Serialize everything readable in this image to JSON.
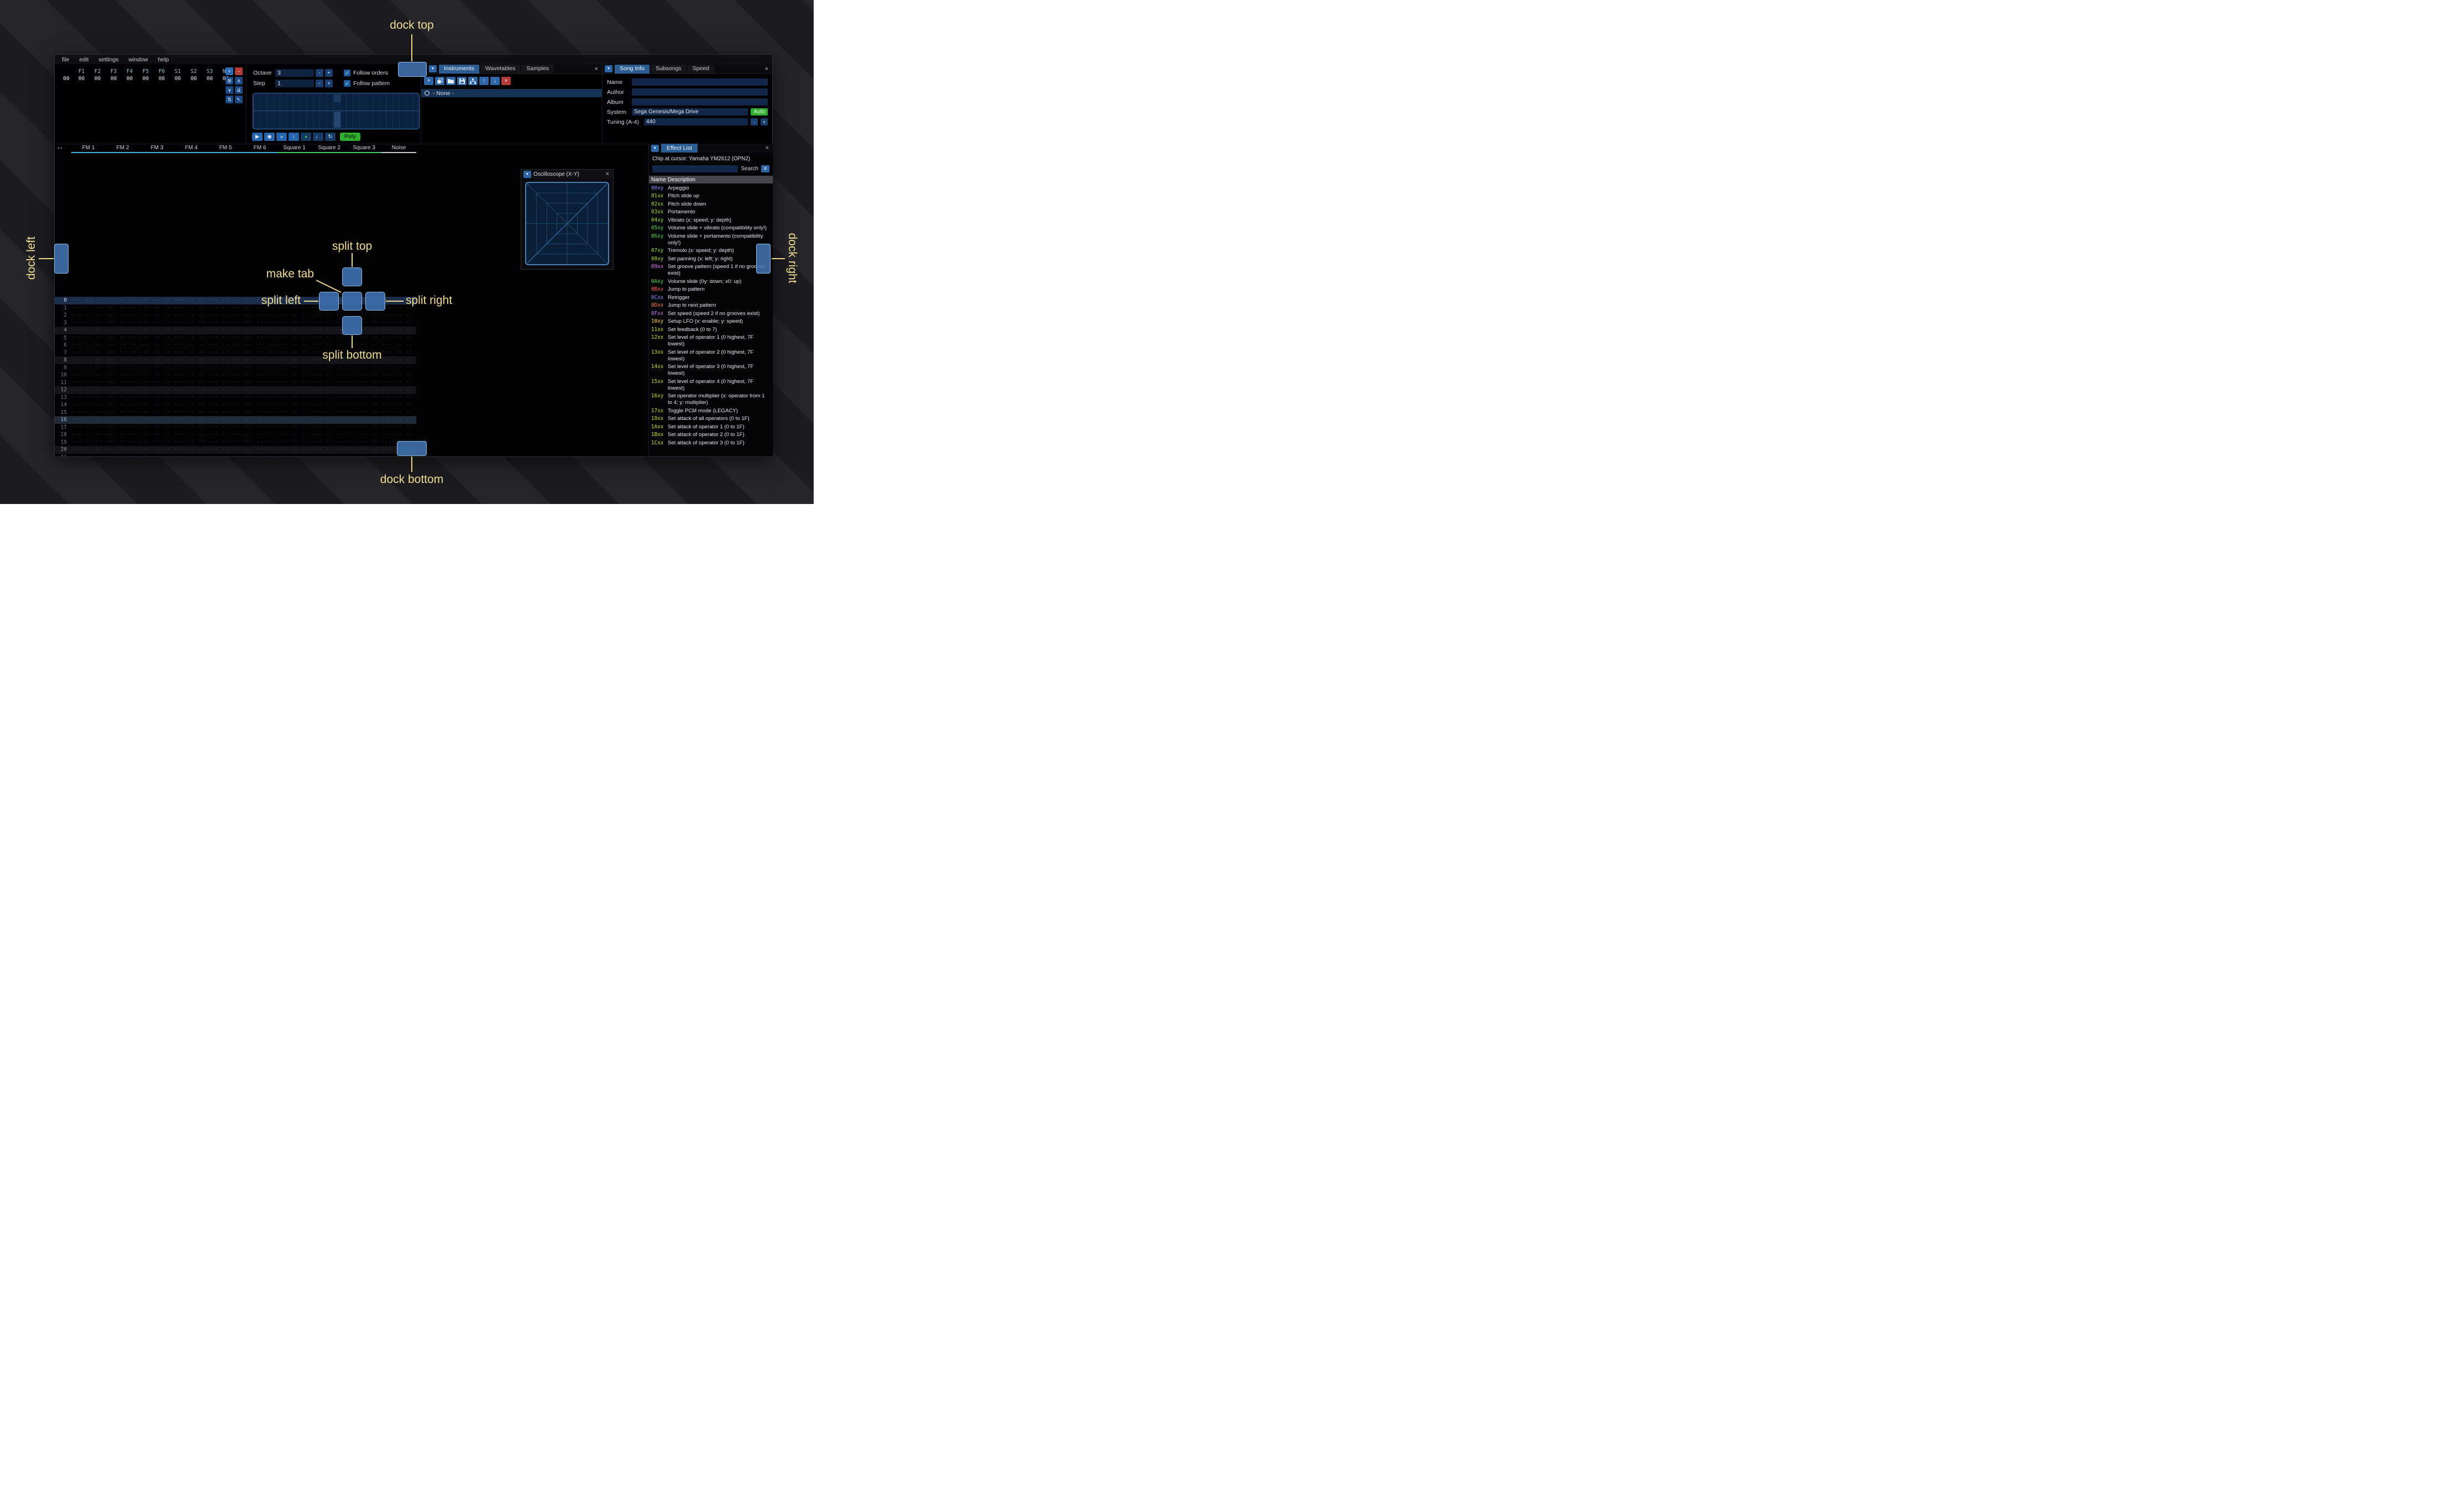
{
  "menu": {
    "items": [
      "file",
      "edit",
      "settings",
      "window",
      "help"
    ]
  },
  "orders": {
    "channels": [
      "F1",
      "F2",
      "F3",
      "F4",
      "F5",
      "F6",
      "S1",
      "S2",
      "S3",
      "N0"
    ],
    "order_index": "00",
    "order_values": [
      "00",
      "00",
      "00",
      "00",
      "00",
      "00",
      "00",
      "00",
      "00",
      "00"
    ],
    "buttons": [
      {
        "name": "add-order-button",
        "glyph": "+",
        "style": "blue"
      },
      {
        "name": "remove-order-button",
        "glyph": "−",
        "style": "red"
      },
      {
        "name": "duplicate-order-button",
        "glyph": "⊞",
        "style": "mid"
      },
      {
        "name": "move-order-up-button",
        "glyph": "∧",
        "style": "mid"
      },
      {
        "name": "move-order-down-button",
        "glyph": "∨",
        "style": "mid"
      },
      {
        "name": "duplicate-order-to-end-button",
        "glyph": "⇊",
        "style": "mid"
      },
      {
        "name": "order-change-mode-button",
        "glyph": "⇅",
        "style": "mid"
      },
      {
        "name": "order-edit-mode-button",
        "glyph": "↖",
        "style": "mid"
      }
    ]
  },
  "controls": {
    "octave_label": "Octave",
    "octave_value": "3",
    "step_label": "Step",
    "step_value": "1",
    "minus_label": "-",
    "plus_label": "+",
    "check_glyph": "✓",
    "follow_orders_label": "Follow orders",
    "follow_pattern_label": "Follow pattern",
    "transport": [
      {
        "name": "play-button",
        "glyph": "▶",
        "style": "blue"
      },
      {
        "name": "play-pattern-button",
        "glyph": "◉",
        "style": "blue"
      },
      {
        "name": "play-once-button",
        "glyph": "»",
        "style": "blue"
      },
      {
        "name": "step-row-button",
        "glyph": "↓",
        "style": "blue"
      },
      {
        "name": "edit-toggle-button",
        "glyph": "●",
        "style": "toggle"
      },
      {
        "name": "metronome-button",
        "glyph": "♩",
        "style": "dark"
      },
      {
        "name": "repeat-pattern-button",
        "glyph": "↻",
        "style": "dark"
      }
    ],
    "poly_label": "Poly"
  },
  "instruments": {
    "collapse_icon": "▼",
    "tabs": [
      "Instruments",
      "Wavetables",
      "Samples"
    ],
    "active_tab": "Instruments",
    "close_icon": "×",
    "toolbar": [
      {
        "name": "add-instrument-button",
        "icon": "plus",
        "style": "blue"
      },
      {
        "name": "duplicate-instrument-button",
        "icon": "copy",
        "style": "blue"
      },
      {
        "name": "open-instrument-button",
        "icon": "folder",
        "style": "blue"
      },
      {
        "name": "save-instrument-button",
        "icon": "floppy",
        "style": "blue"
      },
      {
        "name": "instrument-folder-button",
        "icon": "sitemap",
        "style": "blue"
      },
      {
        "name": "move-instrument-up-button",
        "icon": "arrow-up",
        "style": "blue"
      },
      {
        "name": "move-instrument-down-button",
        "icon": "arrow-down",
        "style": "blue"
      },
      {
        "name": "delete-instrument-button",
        "icon": "delete",
        "style": "red"
      }
    ],
    "none_item": "- None -"
  },
  "song_info": {
    "collapse_icon": "▼",
    "tabs": [
      "Song Info",
      "Subsongs",
      "Speed"
    ],
    "active_tab": "Song Info",
    "close_icon": "×",
    "fields": [
      {
        "label": "Name",
        "value": ""
      },
      {
        "label": "Author",
        "value": ""
      },
      {
        "label": "Album",
        "value": ""
      }
    ],
    "system_label": "System",
    "system_value": "Sega Genesis/Mega Drive",
    "auto_label": "Auto",
    "tuning_label": "Tuning (A-4)",
    "tuning_value": "440",
    "minus_label": "-",
    "plus_label": "+"
  },
  "pattern": {
    "corner_label": "++",
    "channels": [
      {
        "name": "FM 1",
        "underline": "#3fb6e0",
        "width": 62
      },
      {
        "name": "FM 2",
        "underline": "#3fb6e0",
        "width": 62
      },
      {
        "name": "FM 3",
        "underline": "#3fb6e0",
        "width": 62
      },
      {
        "name": "FM 4",
        "underline": "#3fb6e0",
        "width": 62
      },
      {
        "name": "FM 5",
        "underline": "#3fb6e0",
        "width": 62
      },
      {
        "name": "FM 6",
        "underline": "#3fb6e0",
        "width": 62
      },
      {
        "name": "Square 1",
        "underline": "#43d06c",
        "width": 63
      },
      {
        "name": "Square 2",
        "underline": "#43d06c",
        "width": 63
      },
      {
        "name": "Square 3",
        "underline": "#43d06c",
        "width": 63
      },
      {
        "name": "Noise",
        "underline": "#c8ccd2",
        "width": 63
      }
    ],
    "row_count": 22,
    "cursor_row": 0,
    "highlight_major_row": 16,
    "empty_cell": "··· ·· ·· ···"
  },
  "oscilloscope": {
    "collapse_icon": "▼",
    "title": "Oscilloscope (X-Y)",
    "close_icon": "×"
  },
  "effect_list": {
    "collapse_icon": "▼",
    "title": "Effect List",
    "close_icon": "×",
    "chip_line": "Chip at cursor: Yamaha YM2612 (OPN2)",
    "search_label": "Search",
    "menu_icon": "≡",
    "name_header": "Name",
    "desc_header": "Description",
    "effects": [
      {
        "code": "00xy",
        "desc": "Arpeggio",
        "color": "#8c8cff"
      },
      {
        "code": "01xx",
        "desc": "Pitch slide up",
        "color": "#a7dc30"
      },
      {
        "code": "02xx",
        "desc": "Pitch slide down",
        "color": "#a7dc30"
      },
      {
        "code": "03xx",
        "desc": "Portamento",
        "color": "#a7dc30"
      },
      {
        "code": "04xy",
        "desc": "Vibrato (x: speed; y: depth)",
        "color": "#a7dc30"
      },
      {
        "code": "05xy",
        "desc": "Volume slide + vibrato (compatibility only!)",
        "color": "#53d953"
      },
      {
        "code": "06xy",
        "desc": "Volume slide + portamento (compatibility only!)",
        "color": "#53d953"
      },
      {
        "code": "07xy",
        "desc": "Tremolo (x: speed; y: depth)",
        "color": "#a7dc30"
      },
      {
        "code": "08xy",
        "desc": "Set panning (x: left; y: right)",
        "color": "#a7dc30"
      },
      {
        "code": "09xx",
        "desc": "Set groove pattern (speed 1 if no grooves exist)",
        "color": "#e07ce0"
      },
      {
        "code": "0Axy",
        "desc": "Volume slide (0y: down; x0: up)",
        "color": "#53d953"
      },
      {
        "code": "0Bxx",
        "desc": "Jump to pattern",
        "color": "#ff5b5b"
      },
      {
        "code": "0Cxx",
        "desc": "Retrigger",
        "color": "#8c8cff"
      },
      {
        "code": "0Dxx",
        "desc": "Jump to next pattern",
        "color": "#ff7a52"
      },
      {
        "code": "0Fxx",
        "desc": "Set speed (speed 2 if no grooves exist)",
        "color": "#c27cf0"
      },
      {
        "code": "10xy",
        "desc": "Setup LFO (x: enable; y: speed)",
        "color": "#ffd74d"
      },
      {
        "code": "11xx",
        "desc": "Set feedback (0 to 7)",
        "color": "#d3dc30"
      },
      {
        "code": "12xx",
        "desc": "Set level of operator 1 (0 highest, 7F lowest)",
        "color": "#d3dc30"
      },
      {
        "code": "13xx",
        "desc": "Set level of operator 2 (0 highest, 7F lowest)",
        "color": "#d3dc30"
      },
      {
        "code": "14xx",
        "desc": "Set level of operator 3 (0 highest, 7F lowest)",
        "color": "#d3dc30"
      },
      {
        "code": "15xx",
        "desc": "Set level of operator 4 (0 highest, 7F lowest)",
        "color": "#d3dc30"
      },
      {
        "code": "16xy",
        "desc": "Set operator multiplier (x: operator from 1 to 4; y: multiplier)",
        "color": "#d3dc30"
      },
      {
        "code": "17xx",
        "desc": "Toggle PCM mode (LEGACY)",
        "color": "#d3dc30"
      },
      {
        "code": "19xx",
        "desc": "Set attack of all operators (0 to 1F)",
        "color": "#d3dc30"
      },
      {
        "code": "1Axx",
        "desc": "Set attack of operator 1 (0 to 1F)",
        "color": "#d3dc30"
      },
      {
        "code": "1Bxx",
        "desc": "Set attack of operator 2 (0 to 1F)",
        "color": "#d3dc30"
      },
      {
        "code": "1Cxx",
        "desc": "Set attack of operator 3 (0 to 1F)",
        "color": "#d3dc30"
      }
    ]
  },
  "annotations": {
    "color": "#f1dc92",
    "labels": {
      "dock_top": "dock top",
      "dock_bottom": "dock bottom",
      "dock_left": "dock left",
      "dock_right": "dock right",
      "split_top": "split top",
      "split_bottom": "split bottom",
      "split_left": "split left",
      "split_right": "split right",
      "make_tab": "make tab"
    }
  }
}
